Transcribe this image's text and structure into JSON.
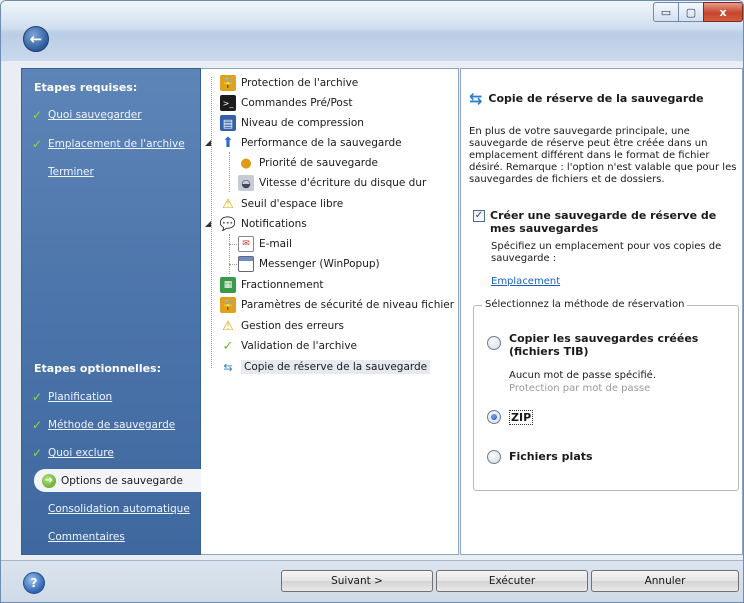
{
  "window": {
    "buttons": {
      "min": "▭",
      "max": "▢",
      "close": "x"
    }
  },
  "steps": {
    "required_heading": "Etapes requises:",
    "required": [
      {
        "label": "Quoi sauvegarder",
        "done": true
      },
      {
        "label": "Emplacement de l'archive",
        "done": true
      },
      {
        "label": "Terminer",
        "done": false
      }
    ],
    "optional_heading": "Etapes optionnelles:",
    "optional": [
      {
        "label": "Planification",
        "done": true
      },
      {
        "label": "Méthode de sauvegarde",
        "done": true
      },
      {
        "label": "Quoi exclure",
        "done": true
      }
    ],
    "current": "Options de sauvegarde",
    "after": [
      {
        "label": "Consolidation automatique"
      },
      {
        "label": "Commentaires"
      }
    ]
  },
  "tree": {
    "items": [
      {
        "label": "Protection de l'archive",
        "icon": "lock-icon"
      },
      {
        "label": "Commandes Pré/Post",
        "icon": "console-icon"
      },
      {
        "label": "Niveau de compression",
        "icon": "archive-icon"
      },
      {
        "label": "Performance de la sauvegarde",
        "icon": "up-arrow-icon"
      },
      {
        "label": "Priorité de sauvegarde",
        "icon": "priority-icon"
      },
      {
        "label": "Vitesse d'écriture du disque dur",
        "icon": "disk-icon"
      },
      {
        "label": "Seuil d'espace libre",
        "icon": "warning-icon"
      },
      {
        "label": "Notifications",
        "icon": "speech-bubble-icon"
      },
      {
        "label": "E-mail",
        "icon": "email-icon"
      },
      {
        "label": "Messenger (WinPopup)",
        "icon": "window-icon"
      },
      {
        "label": "Fractionnement",
        "icon": "split-icon"
      },
      {
        "label": "Paramètres de sécurité de niveau fichier",
        "icon": "security-icon"
      },
      {
        "label": "Gestion des erreurs",
        "icon": "warning-icon"
      },
      {
        "label": "Validation de l'archive",
        "icon": "checkmark-icon"
      },
      {
        "label": "Copie de réserve de la sauvegarde",
        "icon": "copy-arrows-icon"
      }
    ]
  },
  "detail": {
    "title": "Copie de réserve de la sauvegarde",
    "description": "En plus de votre sauvegarde principale, une sauvegarde de réserve peut être créée dans un emplacement différent dans le format de fichier désiré. Remarque : l'option n'est valable que pour les sauvegardes de fichiers et de dossiers.",
    "create_label": "Créer une sauvegarde de réserve de mes sauvegardes",
    "create_checked": true,
    "specify": "Spécifiez un emplacement pour vos copies de sauvegarde :",
    "location_link": "Emplacement",
    "method_legend": "Sélectionnez la méthode de réservation",
    "option_copy": "Copier les sauvegardes créées (fichiers TIB)",
    "copy_note1": "Aucun mot de passe spécifié.",
    "copy_note2": "Protection par mot de passe",
    "option_zip": "ZIP",
    "option_flat": "Fichiers plats",
    "selected": "ZIP"
  },
  "footer": {
    "next": "Suivant >",
    "execute": "Exécuter",
    "cancel": "Annuler"
  }
}
